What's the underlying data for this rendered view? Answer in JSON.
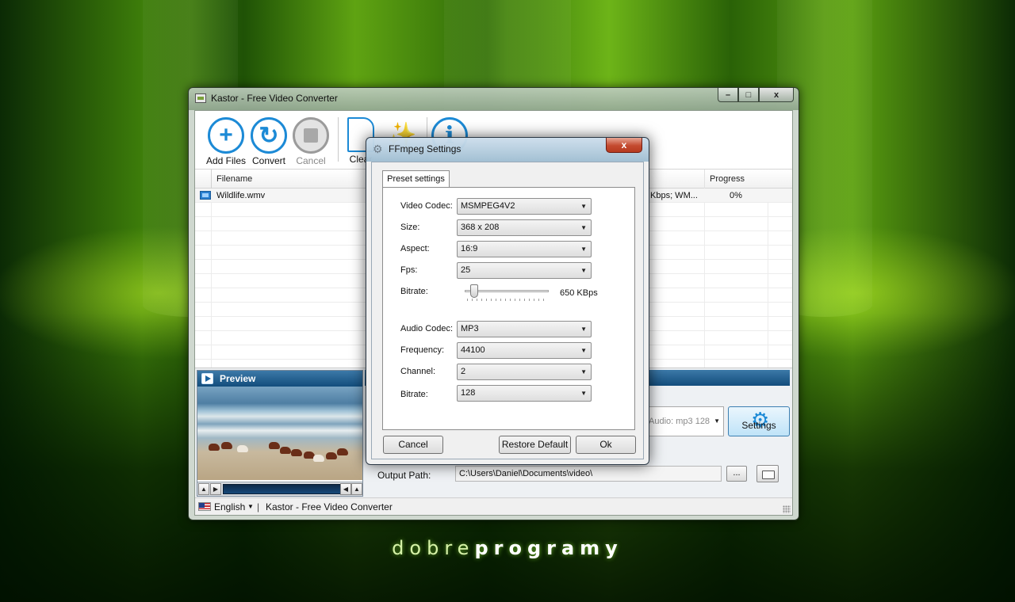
{
  "brand": {
    "thin": "dobre",
    "bold": "programy"
  },
  "main_window": {
    "title": "Kastor - Free Video Converter",
    "controls": {
      "minimize": "–",
      "maximize": "□",
      "close": "x"
    }
  },
  "toolbar": {
    "add_files": "Add Files",
    "convert": "Convert",
    "cancel": "Cancel",
    "clear": "Clear"
  },
  "file_table": {
    "columns": {
      "filename": "Filename",
      "progress": "Progress"
    },
    "rows": [
      {
        "filename": "Wildlife.wmv",
        "info": "Kbps; WM...",
        "progress": "0%"
      }
    ]
  },
  "preview": {
    "title": "Preview"
  },
  "conversion": {
    "audio_summary": "Audio: mp3 128",
    "settings_button": "Settings",
    "output_label": "Output Path:",
    "output_path": "C:\\Users\\Daniel\\Documents\\video\\",
    "browse_button": "..."
  },
  "status_bar": {
    "language": "English",
    "separator": "|",
    "text": "Kastor - Free Video Converter"
  },
  "dialog": {
    "title": "FFmpeg Settings",
    "close": "x",
    "tab": "Preset settings",
    "fields": {
      "video_codec": {
        "label": "Video Codec:",
        "value": "MSMPEG4V2"
      },
      "size": {
        "label": "Size:",
        "value": "368 x 208"
      },
      "aspect": {
        "label": "Aspect:",
        "value": "16:9"
      },
      "fps": {
        "label": "Fps:",
        "value": "25"
      },
      "video_bitrate": {
        "label": "Bitrate:",
        "value": "650 KBps",
        "slider_fraction": 0.07
      },
      "audio_codec": {
        "label": "Audio Codec:",
        "value": "MP3"
      },
      "frequency": {
        "label": "Frequency:",
        "value": "44100"
      },
      "channel": {
        "label": "Channel:",
        "value": "2"
      },
      "audio_bitrate": {
        "label": "Bitrate:",
        "value": "128"
      }
    },
    "buttons": {
      "cancel": "Cancel",
      "restore": "Restore Default",
      "ok": "Ok"
    }
  },
  "colors": {
    "accent": "#1c8ad6",
    "panel_header": "#134d7c",
    "dialog_close": "#c44a2f"
  },
  "icons": {
    "add_files": "plus-circle-icon",
    "convert": "refresh-circle-icon",
    "cancel": "stop-circle-icon",
    "settings": "gear-icon",
    "file": "film-icon"
  }
}
